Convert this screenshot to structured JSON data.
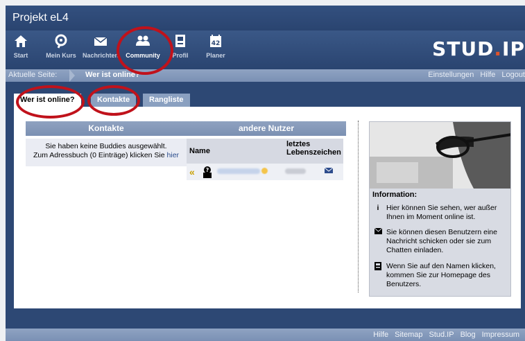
{
  "window": {
    "title": "Projekt eL4"
  },
  "nav": {
    "items": [
      {
        "label": "Start",
        "icon": "home-icon"
      },
      {
        "label": "Mein Kurs",
        "icon": "course-icon"
      },
      {
        "label": "Nachrichten",
        "icon": "mail-icon"
      },
      {
        "label": "Community",
        "icon": "community-icon"
      },
      {
        "label": "Profil",
        "icon": "profile-icon"
      },
      {
        "label": "Planer",
        "icon": "calendar-icon",
        "badge": "42"
      }
    ],
    "active": "Community",
    "logo": {
      "main": "STUD",
      "dot": ".",
      "suffix": "IP"
    }
  },
  "breadcrumb": {
    "label": "Aktuelle Seite:",
    "current": "Wer ist online?",
    "links": [
      "Einstellungen",
      "Hilfe",
      "Logout"
    ]
  },
  "tabs": [
    {
      "label": "Wer ist online?",
      "active": true
    },
    {
      "label": "Kontakte",
      "active": false
    },
    {
      "label": "Rangliste",
      "active": false
    }
  ],
  "main": {
    "left_header": "Kontakte",
    "right_header": "andere Nutzer",
    "no_buddies_line1": "Sie haben keine Buddies ausgewählt.",
    "no_buddies_line2": "Zum Adressbuch (0 Einträge) klicken Sie ",
    "no_buddies_link": "hier",
    "table": {
      "col_name": "Name",
      "col_last_line1": "letztes",
      "col_last_line2": "Lebenszeichen"
    }
  },
  "info": {
    "title": "Information:",
    "items": [
      {
        "icon": "info-icon",
        "text": "Hier können Sie sehen, wer außer Ihnen im Moment online ist."
      },
      {
        "icon": "mail-icon",
        "text": "Sie können diesen Benutzern eine Nachricht schicken oder sie zum Chatten einladen."
      },
      {
        "icon": "profile-icon",
        "text": "Wenn Sie auf den Namen klicken, kommen Sie zur Homepage des Benutzers."
      }
    ]
  },
  "footer": {
    "links": [
      "Hilfe",
      "Sitemap",
      "Stud.IP",
      "Blog",
      "Impressum"
    ]
  },
  "colors": {
    "header_blue": "#2d4874",
    "bar_blue": "#7a90b4",
    "highlight_red": "#c0121b",
    "logo_dot": "#e0542a"
  }
}
